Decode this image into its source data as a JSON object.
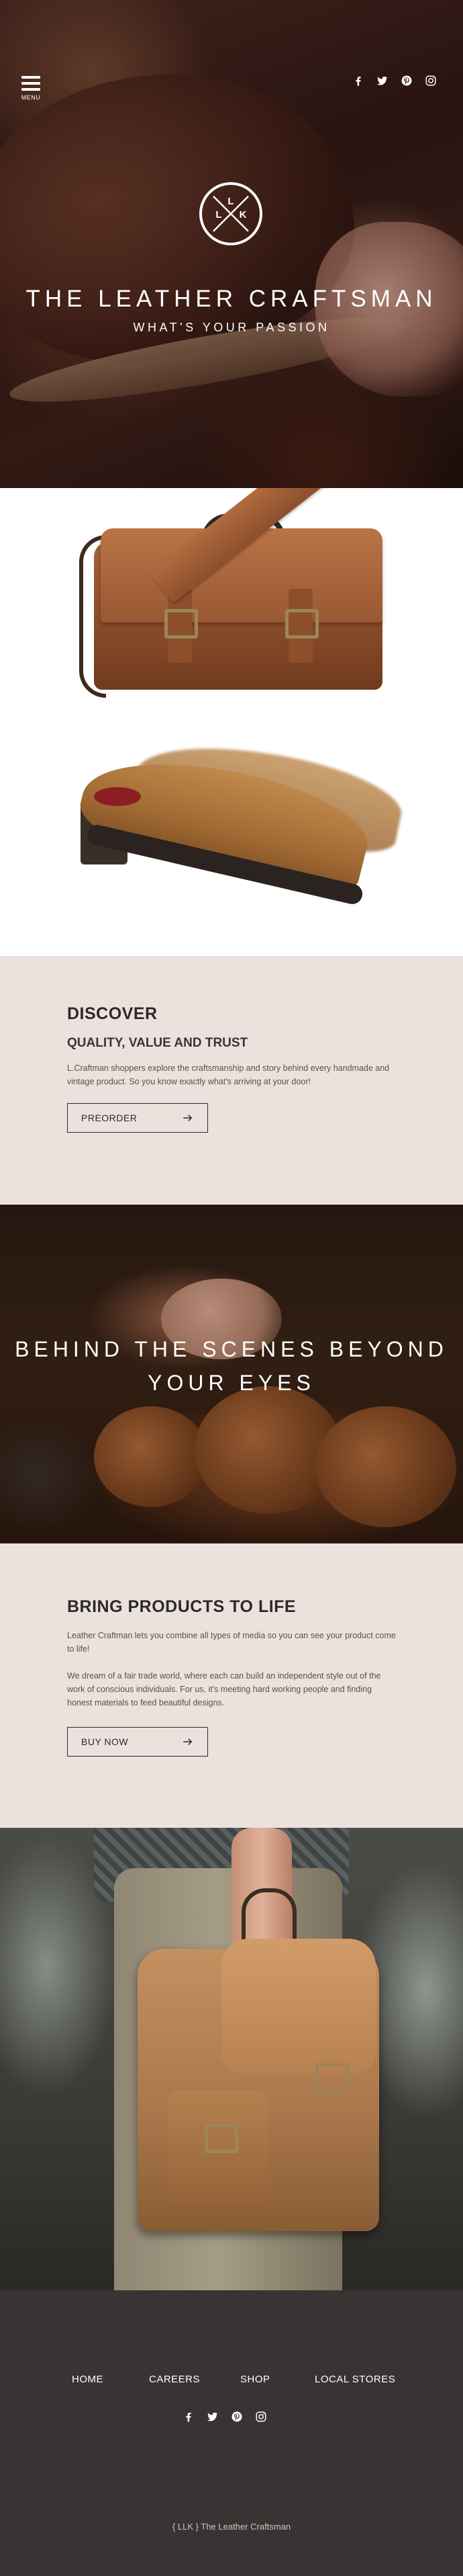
{
  "header": {
    "menu_label": "MENU",
    "social_icons": [
      "facebook-icon",
      "twitter-icon",
      "pinterest-icon",
      "instagram-icon"
    ]
  },
  "hero": {
    "logo_letters": [
      "L",
      "L",
      "K"
    ],
    "title": "THE LEATHER CRAFTSMAN",
    "subtitle": "WHAT'S YOUR PASSION"
  },
  "discover": {
    "heading": "DISCOVER",
    "subheading": "QUALITY, VALUE AND TRUST",
    "paragraph": "L.Craftman shoppers explore the craftsmanship and story behind every handmade and vintage product. So you know exactly what's arriving at your door!",
    "button_label": "PREORDER"
  },
  "behind": {
    "title_line1": "BEHIND THE SCENES BEYOND",
    "title_line2": "YOUR EYES"
  },
  "bring": {
    "heading": "BRING PRODUCTS TO LIFE",
    "paragraph1": "Leather Craftman lets you combine all types of media so you can see your product come to life!",
    "paragraph2": "We dream of a fair trade world, where each can build an independent style out of the work of conscious individuals. For us, it's meeting hard working people and finding honest materials to feed beautiful designs.",
    "button_label": "BUY NOW"
  },
  "footer": {
    "nav": [
      "HOME",
      "CAREERS",
      "SHOP",
      "LOCAL STORES"
    ],
    "social_icons": [
      "facebook-icon",
      "twitter-icon",
      "pinterest-icon",
      "instagram-icon"
    ],
    "copyright": "{ LLK } The Leather Craftsman"
  },
  "colors": {
    "section_bg": "#ebe2dd",
    "footer_bg": "#393433",
    "text_dark": "#2d2928"
  }
}
